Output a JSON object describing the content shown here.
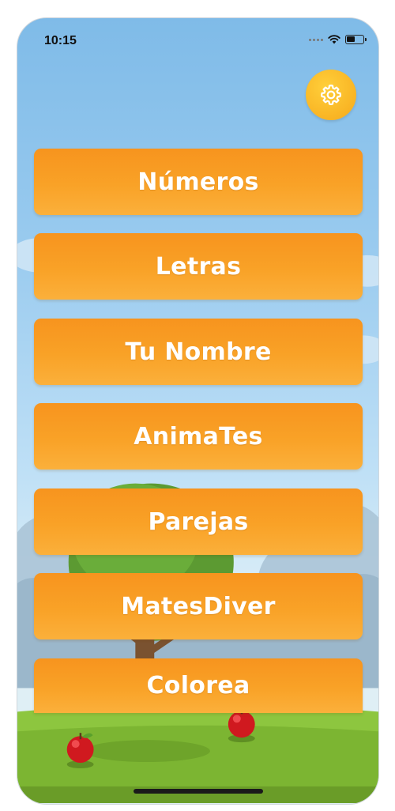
{
  "status_bar": {
    "time": "10:15"
  },
  "settings": {
    "icon": "gear-icon"
  },
  "menu": {
    "items": [
      {
        "label": "Números"
      },
      {
        "label": "Letras"
      },
      {
        "label": "Tu Nombre"
      },
      {
        "label": "AnimaTes"
      },
      {
        "label": "Parejas"
      },
      {
        "label": "MatesDiver"
      },
      {
        "label": "Colorea"
      }
    ]
  },
  "colors": {
    "button": "#f9a227",
    "button_text": "#ffffff",
    "settings_button": "#f9b425",
    "sky": "#8cc4ec",
    "grass": "#8dc63f"
  }
}
